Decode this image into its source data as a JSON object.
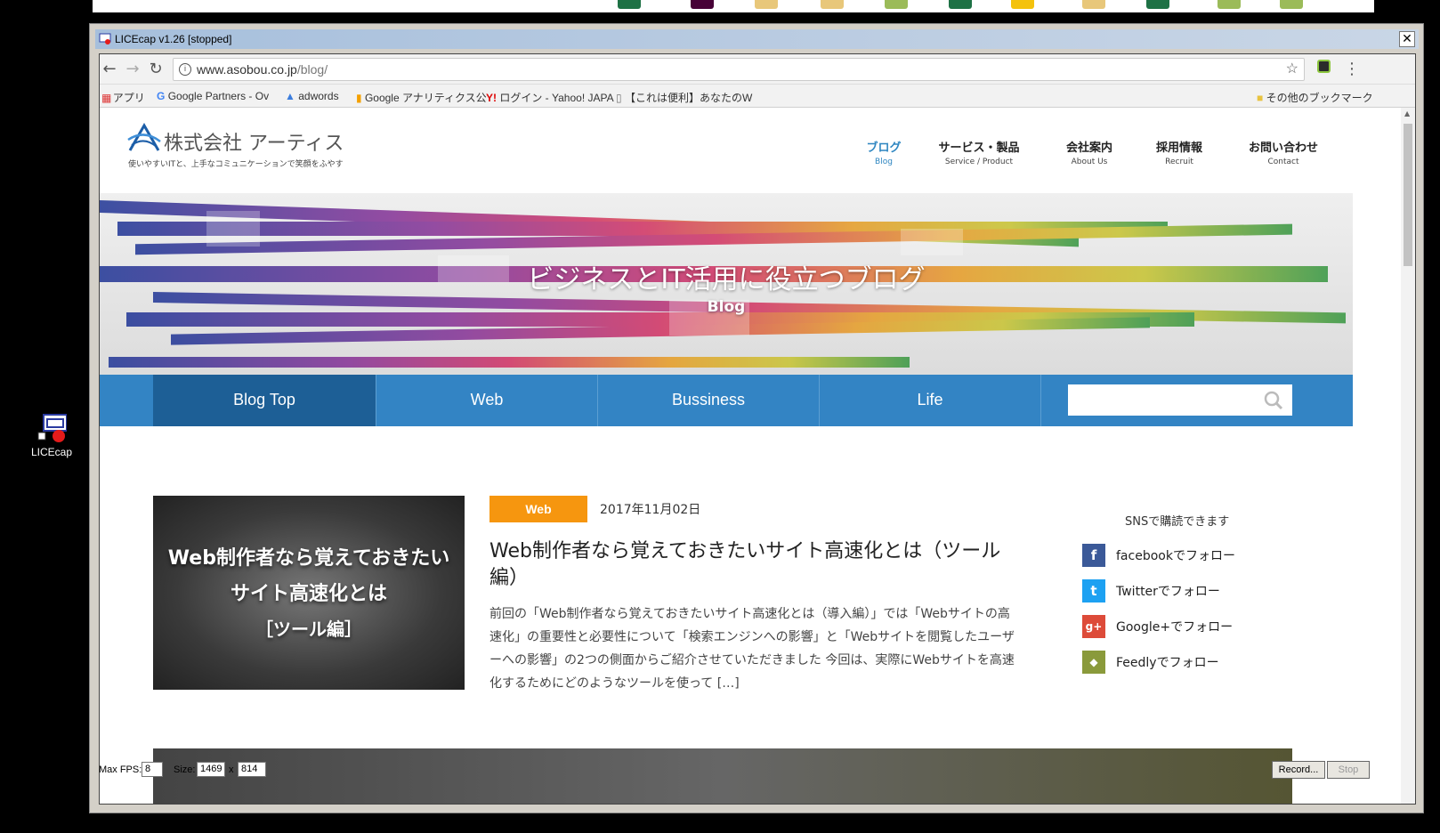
{
  "desktop": {
    "icon_label": "LICEcap"
  },
  "window": {
    "title": "LICEcap v1.26 [stopped]",
    "close_glyph": "✕"
  },
  "browser": {
    "url_host": "www.asobou.co.jp",
    "url_path": "/blog/",
    "bookmarks": [
      {
        "label": "アプリ"
      },
      {
        "label": "Google Partners - Ov"
      },
      {
        "label": "adwords"
      },
      {
        "label": "Google アナリティクス公"
      },
      {
        "label": "ログイン - Yahoo! JAPA"
      },
      {
        "label": "【これは便利】あなたのW"
      },
      {
        "label": "その他のブックマーク"
      }
    ]
  },
  "site": {
    "logo_name": "株式会社 アーティス",
    "logo_tagline": "使いやすいITと、上手なコミュニケーションで笑顔をふやす",
    "nav": [
      {
        "jp": "ブログ",
        "en": "Blog"
      },
      {
        "jp": "サービス・製品",
        "en": "Service / Product"
      },
      {
        "jp": "会社案内",
        "en": "About Us"
      },
      {
        "jp": "採用情報",
        "en": "Recruit"
      },
      {
        "jp": "お問い合わせ",
        "en": "Contact"
      }
    ],
    "hero_title": "ビジネスとIT活用に役立つブログ",
    "hero_sub": "Blog",
    "categories": [
      {
        "label": "Blog Top"
      },
      {
        "label": "Web"
      },
      {
        "label": "Bussiness"
      },
      {
        "label": "Life"
      }
    ],
    "search_placeholder": ""
  },
  "post": {
    "thumb_line1": "Web制作者なら覚えておきたい",
    "thumb_line2": "サイト高速化とは",
    "thumb_line3": "［ツール編］",
    "category": "Web",
    "date": "2017年11月02日",
    "title": "Web制作者なら覚えておきたいサイト高速化とは（ツール編）",
    "excerpt": "前回の「Web制作者なら覚えておきたいサイト高速化とは（導入編）」では「Webサイトの高速化」の重要性と必要性について「検索エンジンへの影響」と「Webサイトを閲覧したユーザーへの影響」の2つの側面からご紹介させていただきました 今回は、実際にWebサイトを高速化するためにどのようなツールを使って […]"
  },
  "sns": {
    "heading": "SNSで購読できます",
    "items": [
      {
        "label": "facebookでフォロー",
        "glyph": "f",
        "color": "#3b5998"
      },
      {
        "label": "Twitterでフォロー",
        "glyph": "t",
        "color": "#1da1f2"
      },
      {
        "label": "Google+でフォロー",
        "glyph": "g+",
        "color": "#dd4b39"
      },
      {
        "label": "Feedlyでフォロー",
        "glyph": "◆",
        "color": "#8a9a3b"
      }
    ]
  },
  "licecap": {
    "fps_label": "Max FPS:",
    "fps_value": "8",
    "size_label": "Size:",
    "width_value": "1469",
    "x_label": "x",
    "height_value": "814",
    "record_label": "Record...",
    "stop_label": "Stop"
  }
}
